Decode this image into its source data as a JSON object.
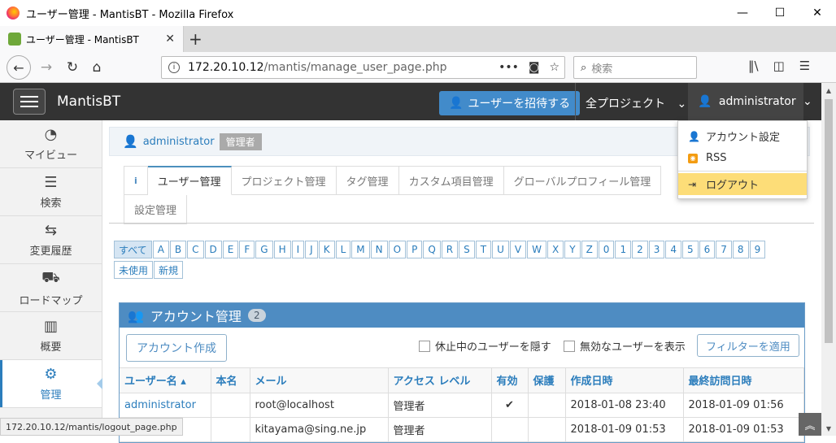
{
  "window": {
    "title": "ユーザー管理 - MantisBT - Mozilla Firefox",
    "minimize": "—",
    "maximize": "☐",
    "close": "✕"
  },
  "tab": {
    "label": "ユーザー管理 - MantisBT",
    "close": "✕",
    "new": "+"
  },
  "nav": {
    "url_host": "172.20.10.12",
    "url_path": "/mantis/manage_user_page.php",
    "search_placeholder": "検索",
    "back": "←",
    "forward": "→",
    "reload": "↻",
    "home": "⌂",
    "more": "•••",
    "pocket": "◙",
    "star": "☆",
    "library": "‖\\",
    "sidebar": "◫",
    "menu": "☰"
  },
  "app": {
    "brand": "MantisBT",
    "invite_label": "ユーザーを招待する",
    "all_projects": "全プロジェクト",
    "user": "administrator",
    "chevron": "⌄"
  },
  "sidebar": {
    "items": [
      {
        "label": "マイビュー",
        "icon": "◔",
        "active": false
      },
      {
        "label": "検索",
        "icon": "☰",
        "active": false
      },
      {
        "label": "変更履歴",
        "icon": "⇆",
        "active": false
      },
      {
        "label": "ロードマップ",
        "icon": "⛟",
        "active": false
      },
      {
        "label": "概要",
        "icon": "▥",
        "active": false
      },
      {
        "label": "管理",
        "icon": "⚙",
        "active": true
      }
    ]
  },
  "breadcrumb": {
    "user": "administrator",
    "level": "管理者"
  },
  "tabs": {
    "row1": [
      "ユーザー管理",
      "プロジェクト管理",
      "タグ管理",
      "カスタム項目管理",
      "グローバルプロフィール管理"
    ],
    "row2": [
      "設定管理"
    ],
    "info": "i",
    "active_index": 0
  },
  "letters": [
    "すべて",
    "A",
    "B",
    "C",
    "D",
    "E",
    "F",
    "G",
    "H",
    "I",
    "J",
    "K",
    "L",
    "M",
    "N",
    "O",
    "P",
    "Q",
    "R",
    "S",
    "T",
    "U",
    "V",
    "W",
    "X",
    "Y",
    "Z",
    "0",
    "1",
    "2",
    "3",
    "4",
    "5",
    "6",
    "7",
    "8",
    "9",
    "未使用",
    "新規"
  ],
  "widget": {
    "title": "アカウント管理",
    "count": "2",
    "create_label": "アカウント作成",
    "hide_inactive": "休止中のユーザーを隠す",
    "show_disabled": "無効なユーザーを表示",
    "filter_label": "フィルターを適用"
  },
  "table": {
    "headers": [
      "ユーザー名 ▴",
      "本名",
      "メール",
      "アクセス レベル",
      "有効",
      "保護",
      "作成日時",
      "最終訪問日時"
    ],
    "rows": [
      [
        "administrator",
        "",
        "root@localhost",
        "管理者",
        "✔",
        "",
        "2018-01-08 23:40",
        "2018-01-09 01:56"
      ],
      [
        "",
        "",
        "kitayama@sing.ne.jp",
        "管理者",
        "",
        "",
        "2018-01-09 01:53",
        "2018-01-09 01:53"
      ]
    ]
  },
  "dropdown": {
    "account": "アカウント設定",
    "rss": "RSS",
    "logout": "ログアウト",
    "rss_icon": "◉"
  },
  "status_url": "172.20.10.12/mantis/logout_page.php",
  "to_top": "︽",
  "scroll_up": "▲",
  "scroll_down": "▼",
  "colors": {
    "primary": "#428bca",
    "nav": "#333333",
    "highlight": "#fddd78"
  }
}
